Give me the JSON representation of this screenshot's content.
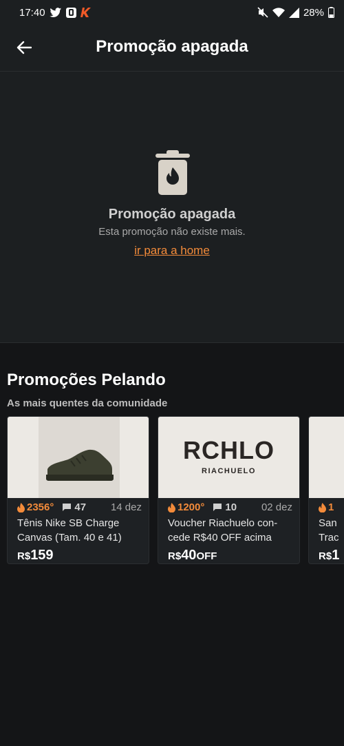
{
  "status": {
    "time": "17:40",
    "battery": "28%"
  },
  "header": {
    "title": "Promoção apagada"
  },
  "empty_state": {
    "title": "Promoção apagada",
    "subtitle": "Esta promoção não existe mais.",
    "link": "ir para a home"
  },
  "section": {
    "title": "Promoções Pelando",
    "subtitle": "As mais quentes da comunidade"
  },
  "deals": [
    {
      "temperature": "2356°",
      "comments": "47",
      "date": "14 dez",
      "title": "Tênis Nike SB Charge Canvas (Tam. 40 e 41)",
      "currency": "R$",
      "price": "159",
      "suffix": ""
    },
    {
      "temperature": "1200°",
      "comments": "10",
      "date": "02 dez",
      "title": "Voucher Riachuelo con- cede R$40 OFF acima",
      "currency": "R$",
      "price": "40",
      "suffix": "OFF",
      "brand": "RCHLO",
      "brand_sub": "RIACHUELO"
    },
    {
      "temperature": "1",
      "title": "San Trac",
      "currency": "R$",
      "price": "1"
    }
  ],
  "colors": {
    "accent": "#f38b3a",
    "background": "#141517",
    "surface": "#1c1f21"
  }
}
